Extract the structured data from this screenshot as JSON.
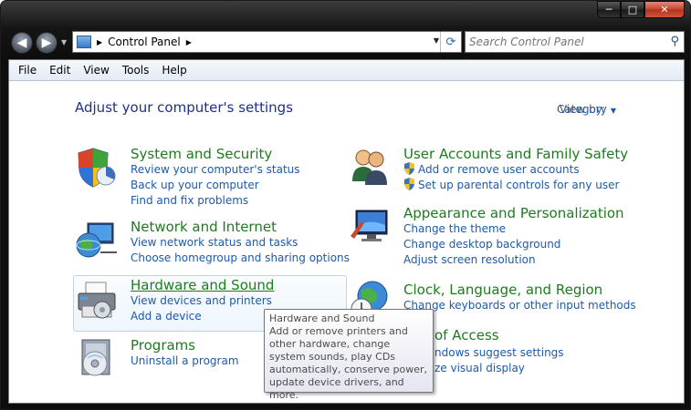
{
  "window": {
    "caption_min": "─",
    "caption_max": "□",
    "caption_close": "✕"
  },
  "nav": {
    "back_glyph": "◀",
    "forward_glyph": "▶",
    "address_crumb": "Control Panel",
    "search_placeholder": "Search Control Panel"
  },
  "menu": {
    "items": [
      "File",
      "Edit",
      "View",
      "Tools",
      "Help"
    ]
  },
  "main": {
    "heading": "Adjust your computer's settings",
    "view_by_label": "View by:",
    "view_by_value": "Category"
  },
  "categories": {
    "system": {
      "title": "System and Security",
      "links": [
        "Review your computer's status",
        "Back up your computer",
        "Find and fix problems"
      ]
    },
    "network": {
      "title": "Network and Internet",
      "links": [
        "View network status and tasks",
        "Choose homegroup and sharing options"
      ]
    },
    "hardware": {
      "title": "Hardware and Sound",
      "links": [
        "View devices and printers",
        "Add a device"
      ]
    },
    "programs": {
      "title": "Programs",
      "links": [
        "Uninstall a program"
      ]
    },
    "users": {
      "title": "User Accounts and Family Safety",
      "links": [
        "Add or remove user accounts",
        "Set up parental controls for any user"
      ]
    },
    "appearance": {
      "title": "Appearance and Personalization",
      "links": [
        "Change the theme",
        "Change desktop background",
        "Adjust screen resolution"
      ]
    },
    "clock": {
      "title": "Clock, Language, and Region",
      "links": [
        "Change keyboards or other input methods"
      ]
    },
    "ease": {
      "title": "of Access",
      "links": [
        "ndows suggest settings",
        "ze visual display"
      ]
    }
  },
  "tooltip": {
    "title": "Hardware and Sound",
    "body": "Add or remove printers and other hardware, change system sounds, play CDs automatically, conserve power, update device drivers, and more."
  }
}
